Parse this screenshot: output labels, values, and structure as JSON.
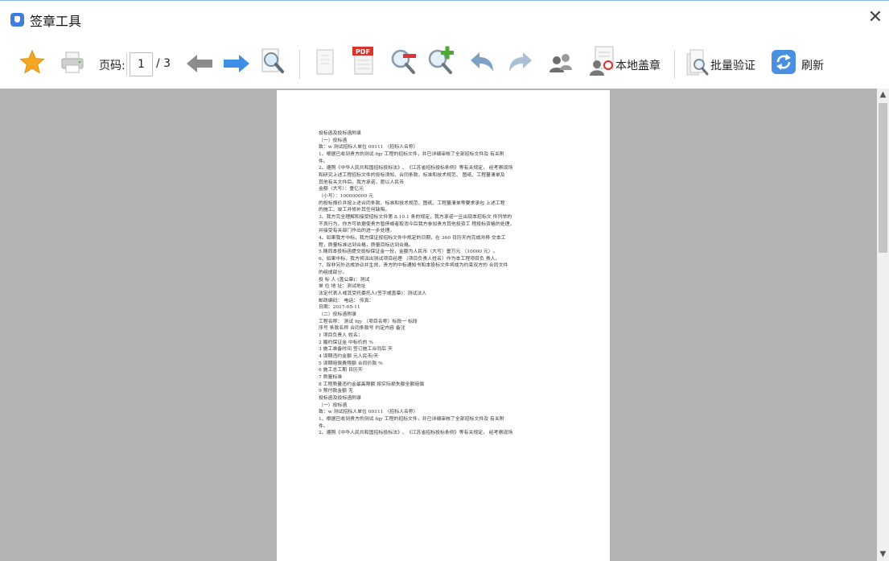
{
  "window": {
    "title": "签章工具",
    "close_symbol": "✕"
  },
  "toolbar": {
    "page_label": "页码:",
    "page_current": "1",
    "page_total": "/ 3",
    "local_seal_label": "本地盖章",
    "batch_verify_label": "批量验证",
    "refresh_label": "刷新",
    "pdf_badge": "PDF"
  },
  "icons": [
    "star-icon",
    "printer-icon",
    "arrow-left-icon",
    "arrow-right-icon",
    "zoom-page-icon",
    "blank-page-icon",
    "pdf-icon",
    "zoom-out-icon",
    "zoom-in-icon",
    "undo-icon",
    "redo-icon",
    "users-icon",
    "local-seal-icon",
    "batch-verify-icon",
    "refresh-icon"
  ],
  "colors": {
    "accent": "#3d7fe0",
    "viewer_bg": "#b3b3b3",
    "arrow_blue": "#3d8ee6",
    "star": "#f5a623"
  },
  "document": {
    "lines": [
      "投标函及投标函附录",
      "（一）投标函",
      "致：w 测试招标人单位 00111 （招标人名称）",
      "1、根据已收到贵方的测试 fqy 工程的招标文件，并已详细审核了全部招标文件及 有关附",
      "件。",
      "2、遵照《中华人民共和国招标投标法》、《江苏省招标投标条例》等有关规定， 经考察现场",
      "和研究上述工程招标文件的投标须知、合同条款、标准和技术规范、 图纸、工程量清单及",
      "其他有关文件后，我方承诺，愿以人民币",
      "金额（大写）：壹亿元",
      "（小写）：100000000 元",
      "的投标报价并按上述合同条款、标准和技术规范、图纸、工程量清单等要求承包 上述工程",
      "的施工、竣工并修补其任何缺陷。",
      "3、我方完全理解和接受招标文件第 8.10.1 条的规定，我方承诺一旦出现本招标文 件列举的",
      "不良行为，你方可依据使贵方暂停或者取消今后我方参加贵方其他投资工 程投标资格的处理，",
      "并接受有关部门作出的进一步处理。",
      "4、如果我方中标，我方保证按招标文件中规定的日期，在 360 日历天内完成并移 交本工",
      "程，质量标准达到合格，质量目标达到合格。",
      "5.随同本投标函提交投标保证金一份，金额为人民币（大写）壹万元 （10000 元）。",
      "6、如果中标，我方将派出测试项目经理 （项目负责人姓名）作为本工程项目负 责人。",
      "7、除非另外达成协议并生效，贵方的中标通知书和本投标文件将成为约束双方的 合同文件",
      "的组成部分。",
      "投 标 人 (盖公章)：测试",
      "单 位 地 址：测试地址",
      "法定代表人或其受托委托人(签字或盖章)：测试法人",
      "邮政编码： 电话： 传真：",
      "日期：2017-05-11",
      "（二）投标函附录",
      "工程名称： 测试 fqy （项目名称）标段一 标段",
      "序号 条款名称 合同条款号 约定内容 备注",
      "1 项目负责人 姓名：",
      "2 履约保证金 中标价的 %",
      "3 施工准备时间 签订施工合同后 天",
      "4 误期违约金额 元人民币/天",
      "5 误期赔偿费限额 合同价款 %",
      "6 施工总工期 日历天",
      "7 质量标准",
      "8 工程质量违约金最高限额 按实际损失额全额赔偿",
      "9 预付款金额 无",
      "投标函及投标函附录",
      "（一）投标函",
      "致：w 测试招标人单位 00111 （招标人名称）",
      "1、根据已收到贵方的测试 fqy 工程的招标文件，并已详细审核了全部招标文件及 有关附",
      "件。",
      "2、遵照《中华人民共和国招标投标法》、《江苏省招标投标条例》等有关规定， 经考察现场"
    ]
  }
}
